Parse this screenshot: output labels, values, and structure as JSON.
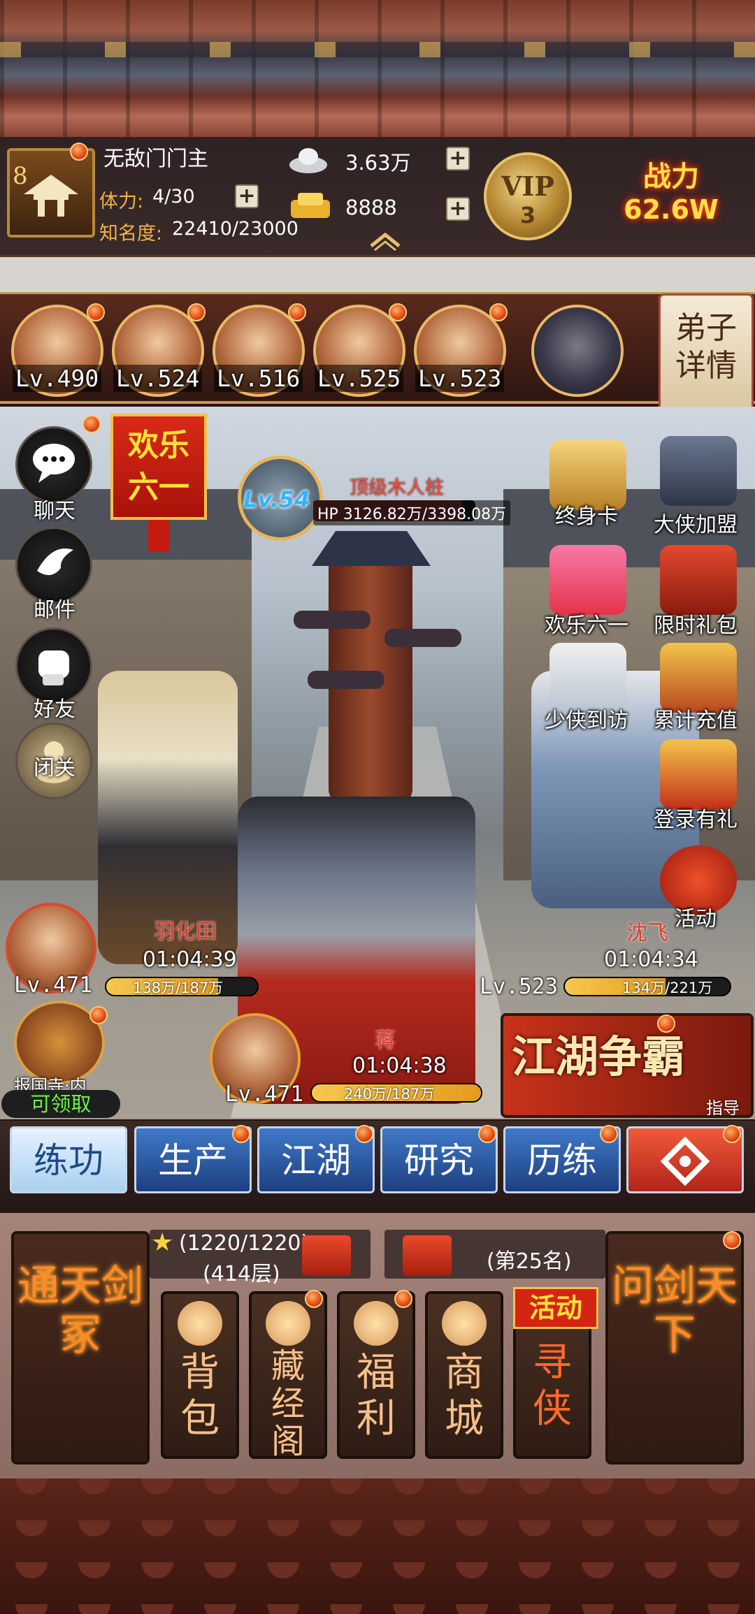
{
  "player": {
    "level": "8",
    "name": "无敌门门主",
    "stamina_label": "体力:",
    "stamina": "4/30",
    "fame_label": "知名度:",
    "fame": "22410/23000",
    "silver": "3.63万",
    "gold": "8888",
    "vip_label": "VIP",
    "vip_level": "3",
    "power_label": "战力",
    "power_value": "62.6W"
  },
  "team": [
    {
      "level": "Lv.490"
    },
    {
      "level": "Lv.524"
    },
    {
      "level": "Lv.516"
    },
    {
      "level": "Lv.525"
    },
    {
      "level": "Lv.523"
    }
  ],
  "detail_card": {
    "line1": "弟子",
    "line2": "详情"
  },
  "left_menu": [
    {
      "label": "聊天",
      "icon": "chat-bubble-icon"
    },
    {
      "label": "邮件",
      "icon": "dove-icon"
    },
    {
      "label": "好友",
      "icon": "fist-icon"
    },
    {
      "label": "闭关",
      "icon": "meditation-icon"
    }
  ],
  "banner_61": {
    "line1": "欢乐",
    "line2": "六一"
  },
  "target": {
    "level": "Lv.54",
    "name": "顶级木人桩",
    "hp": "HP 3126.82万/3398.08万",
    "hp_fraction": 0.92
  },
  "right_menu": [
    {
      "label": "终身卡"
    },
    {
      "label": "大侠加盟"
    },
    {
      "label": "欢乐六一"
    },
    {
      "label": "限时礼包"
    },
    {
      "label": "少侠到访"
    },
    {
      "label": "累计充值"
    },
    {
      "label": "登录有礼"
    },
    {
      "label": "活动"
    }
  ],
  "fighters": [
    {
      "name": "羽化田",
      "timer": "01:04:39",
      "level": "Lv.471",
      "hp": "138万/187万",
      "hp_fraction": 0.74
    },
    {
      "name": "蒋",
      "timer": "01:04:38",
      "level": "Lv.471",
      "hp": "240万/187万",
      "hp_fraction": 1.0
    },
    {
      "name": "沈飞",
      "timer": "01:04:34",
      "level": "Lv.523",
      "hp": "134万/221万",
      "hp_fraction": 0.61
    }
  ],
  "baoguo": {
    "label": "报国寺·内",
    "claim": "可领取"
  },
  "jianghu": {
    "title": "江湖争霸",
    "guide": "指导"
  },
  "tabs": [
    {
      "label": "练功"
    },
    {
      "label": "生产"
    },
    {
      "label": "江湖"
    },
    {
      "label": "研究"
    },
    {
      "label": "历练"
    }
  ],
  "bottom": {
    "left_card": "通天剑冢",
    "right_card": "问剑天下",
    "stars": "(1220/1220)",
    "floors": "(414层)",
    "rank": "(第25名)",
    "menu": [
      {
        "label": "背包",
        "icon": "bag-icon"
      },
      {
        "label": "藏经阁",
        "icon": "pavilion-icon"
      },
      {
        "label": "福利",
        "icon": "coin-icon"
      },
      {
        "label": "商城",
        "icon": "shop-icon"
      },
      {
        "label": "寻侠",
        "icon": "search-hero-icon"
      }
    ],
    "activity_tag": "活动"
  }
}
